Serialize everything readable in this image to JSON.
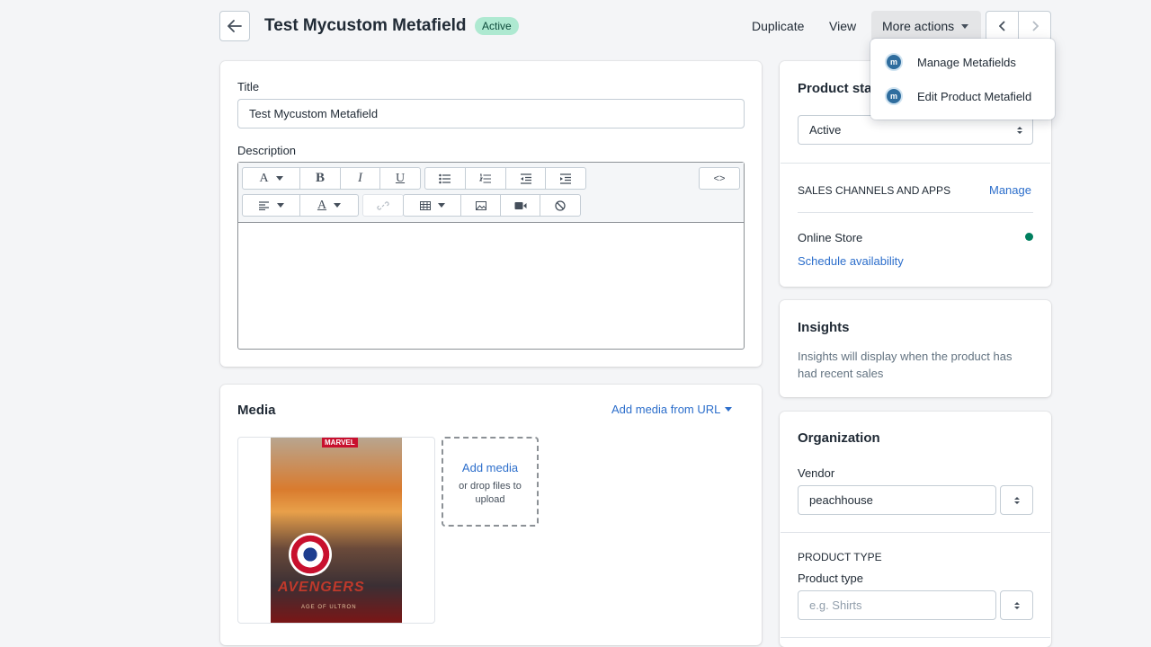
{
  "header": {
    "title": "Test Mycustom Metafield",
    "status": "Active",
    "duplicate_label": "Duplicate",
    "view_label": "View",
    "more_actions_label": "More actions"
  },
  "dropdown": {
    "items": [
      {
        "label": "Manage Metafields",
        "icon": "app-icon"
      },
      {
        "label": "Edit Product Metafield",
        "icon": "app-icon"
      }
    ]
  },
  "general": {
    "title_label": "Title",
    "title_value": "Test Mycustom Metafield",
    "description_label": "Description",
    "html_toggle_label": "<>"
  },
  "media": {
    "heading": "Media",
    "add_from_url_label": "Add media from URL",
    "add_media_label": "Add media",
    "drop_hint": "or drop files to upload",
    "poster_brand": "MARVEL",
    "poster_title": "AVENGERS",
    "poster_subtitle": "AGE OF ULTRON"
  },
  "status_card": {
    "heading": "Product sta",
    "status_value": "Active",
    "channels_heading": "SALES CHANNELS AND APPS",
    "manage_label": "Manage",
    "online_store_label": "Online Store",
    "schedule_label": "Schedule availability",
    "online_dot_color": "#007f5f"
  },
  "insights": {
    "heading": "Insights",
    "text": "Insights will display when the product has had recent sales"
  },
  "organization": {
    "heading": "Organization",
    "vendor_label": "Vendor",
    "vendor_value": "peachhouse",
    "product_type_heading": "PRODUCT TYPE",
    "product_type_label": "Product type",
    "product_type_placeholder": "e.g. Shirts"
  },
  "colors": {
    "accent": "#2c6ecb",
    "badge_bg": "#aee9d1",
    "page_bg": "#f4f5f7"
  }
}
